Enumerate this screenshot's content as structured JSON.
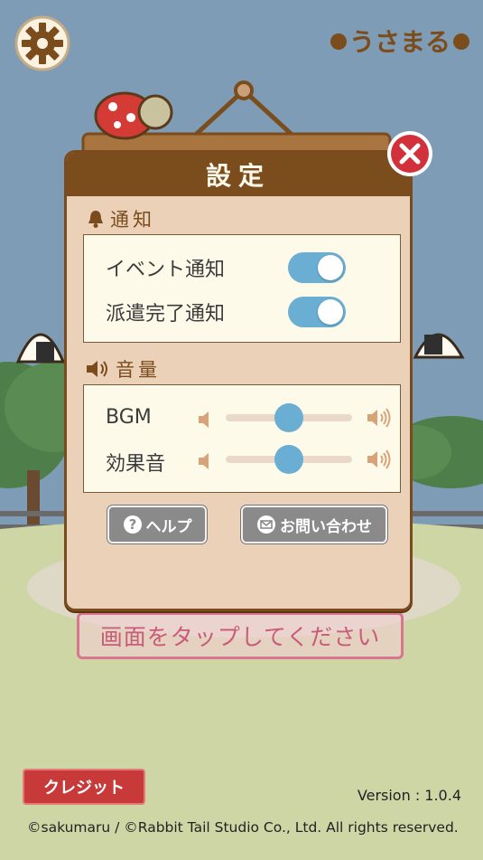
{
  "app": {
    "logo_text": "うさまる"
  },
  "settings": {
    "title": "設定",
    "notification": {
      "heading": "通知",
      "items": [
        {
          "label": "イベント通知",
          "enabled": true
        },
        {
          "label": "派遣完了通知",
          "enabled": true
        }
      ]
    },
    "volume": {
      "heading": "音量",
      "items": [
        {
          "label": "BGM",
          "level": 0.5
        },
        {
          "label": "効果音",
          "level": 0.5
        }
      ]
    },
    "help_label": "ヘルプ",
    "contact_label": "お問い合わせ"
  },
  "footer": {
    "tap_prompt": "画面をタップしてください",
    "credit_label": "クレジット",
    "version": "Version : 1.0.4",
    "copyright": "©sakumaru / ©Rabbit Tail Studio Co., Ltd. All rights reserved."
  },
  "colors": {
    "header_brown": "#7b4d1c",
    "dialog_bg": "#ecd1b9",
    "toggle_on": "#6aaed3",
    "close_red": "#d2303a",
    "credit_red": "#c83a3a"
  }
}
